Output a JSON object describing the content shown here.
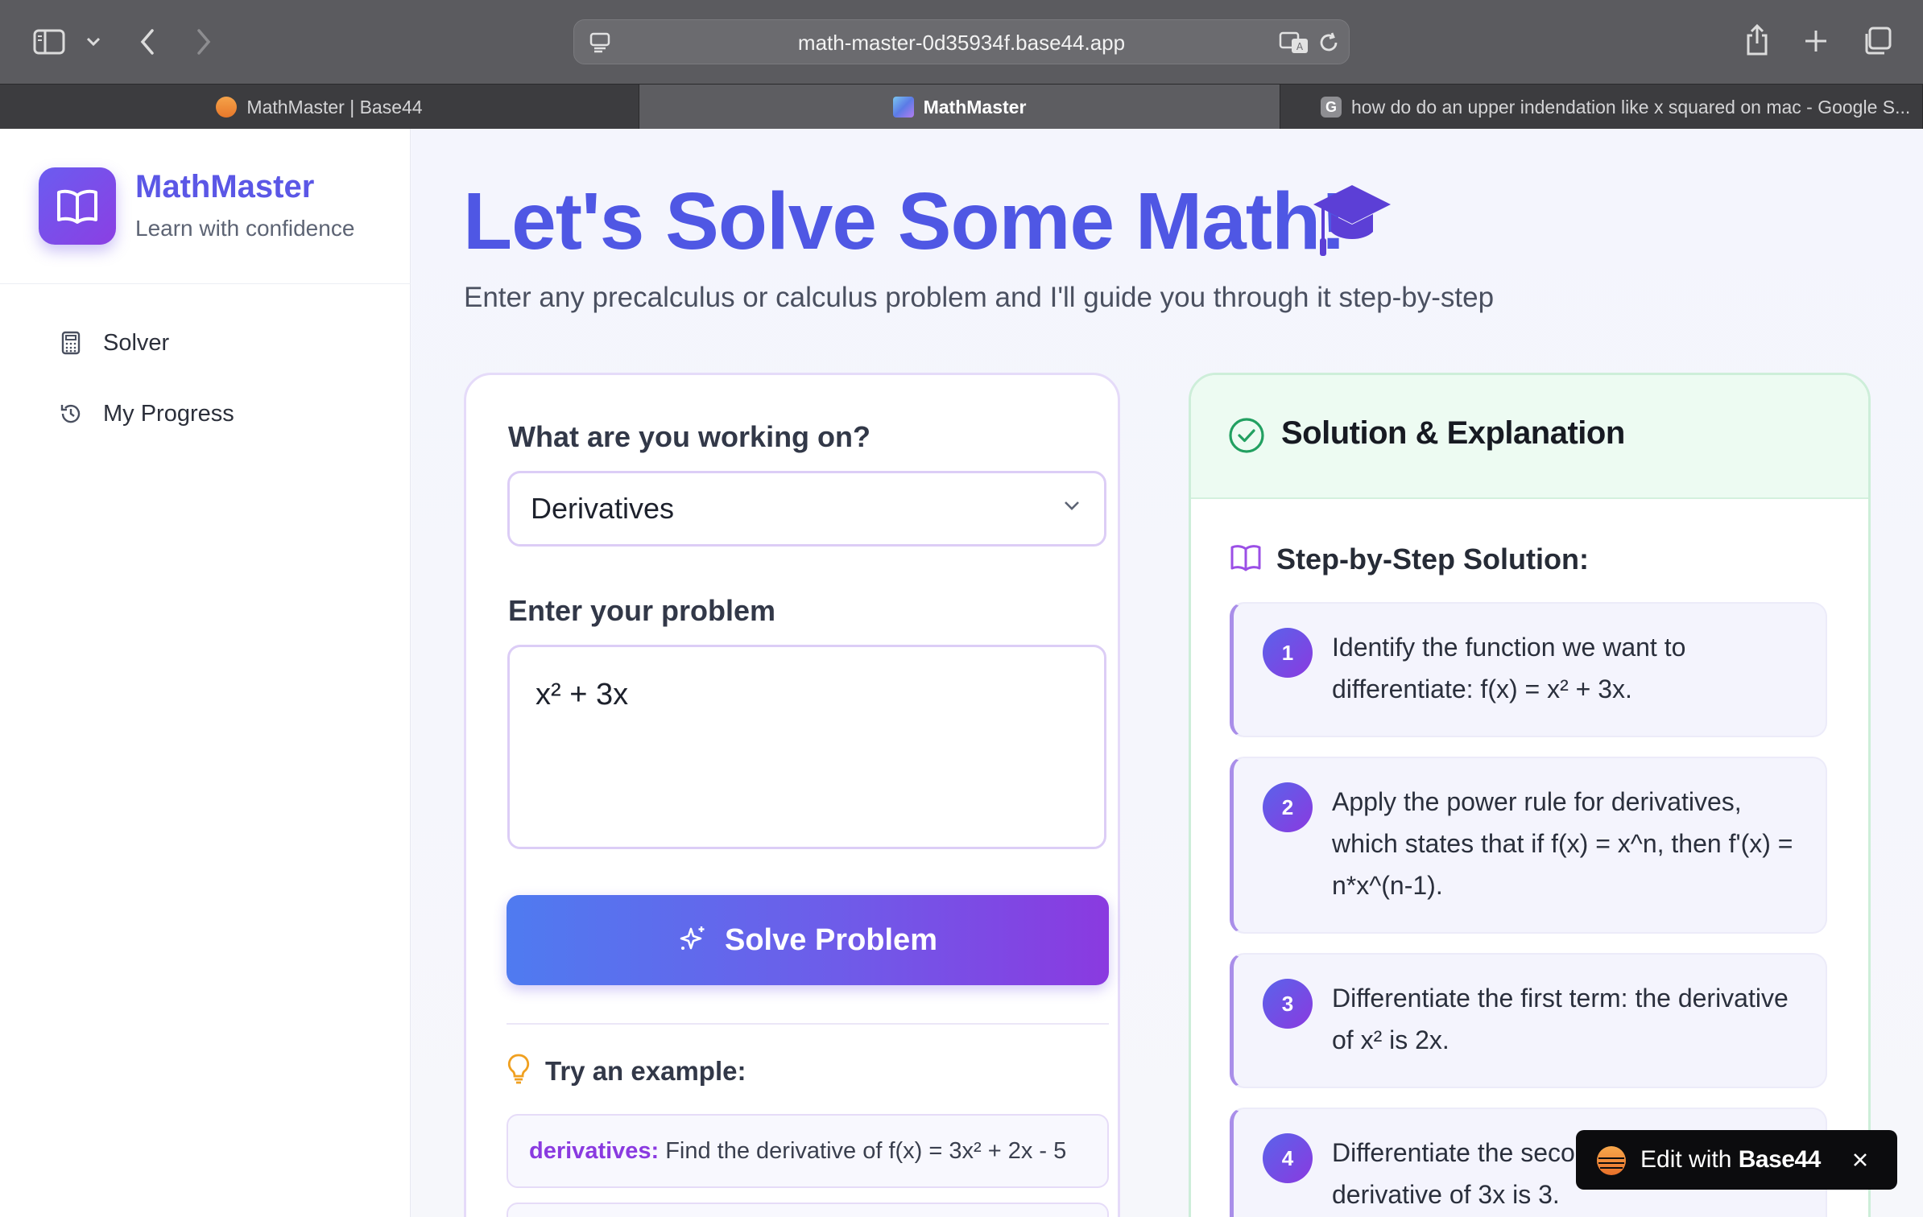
{
  "browser": {
    "url": "math-master-0d35934f.base44.app",
    "tabs": [
      {
        "label": "MathMaster | Base44"
      },
      {
        "label": "MathMaster"
      },
      {
        "label": "how do do an upper indendation like x squared on mac - Google S..."
      }
    ]
  },
  "sidebar": {
    "brand_name": "MathMaster",
    "brand_tagline": "Learn with confidence",
    "items": [
      {
        "label": "Solver",
        "icon": "calculator-icon"
      },
      {
        "label": "My Progress",
        "icon": "history-icon"
      }
    ]
  },
  "main": {
    "title": "Let's Solve Some Math!",
    "subtitle": "Enter any precalculus or calculus problem and I'll guide you through it step-by-step",
    "form": {
      "topic_label": "What are you working on?",
      "topic_value": "Derivatives",
      "problem_label": "Enter your problem",
      "problem_value": "x² + 3x",
      "solve_label": "Solve Problem",
      "examples_label": "Try an example:",
      "examples": [
        {
          "category": "derivatives:",
          "text": "Find the derivative of f(x) = 3x² + 2x - 5"
        },
        {
          "category": "",
          "text": ""
        }
      ]
    },
    "solution": {
      "title": "Solution & Explanation",
      "steps_label": "Step-by-Step Solution:",
      "steps": [
        {
          "num": "1",
          "text": "Identify the function we want to differentiate: f(x) = x² + 3x."
        },
        {
          "num": "2",
          "text": "Apply the power rule for derivatives, which states that if f(x) = x^n, then f'(x) = n*x^(n-1)."
        },
        {
          "num": "3",
          "text": "Differentiate the first term: the derivative of x² is 2x."
        },
        {
          "num": "4",
          "text": "Differentiate the second term: the derivative of 3x is 3."
        }
      ]
    }
  },
  "toast": {
    "prefix": "Edit with",
    "brand": "Base44"
  },
  "colors": {
    "accent": "#5b57e6",
    "gradient_start": "#4f7bf0",
    "gradient_end": "#8a3ae0",
    "success": "#22a061",
    "example_category": "#8a3ae0"
  }
}
